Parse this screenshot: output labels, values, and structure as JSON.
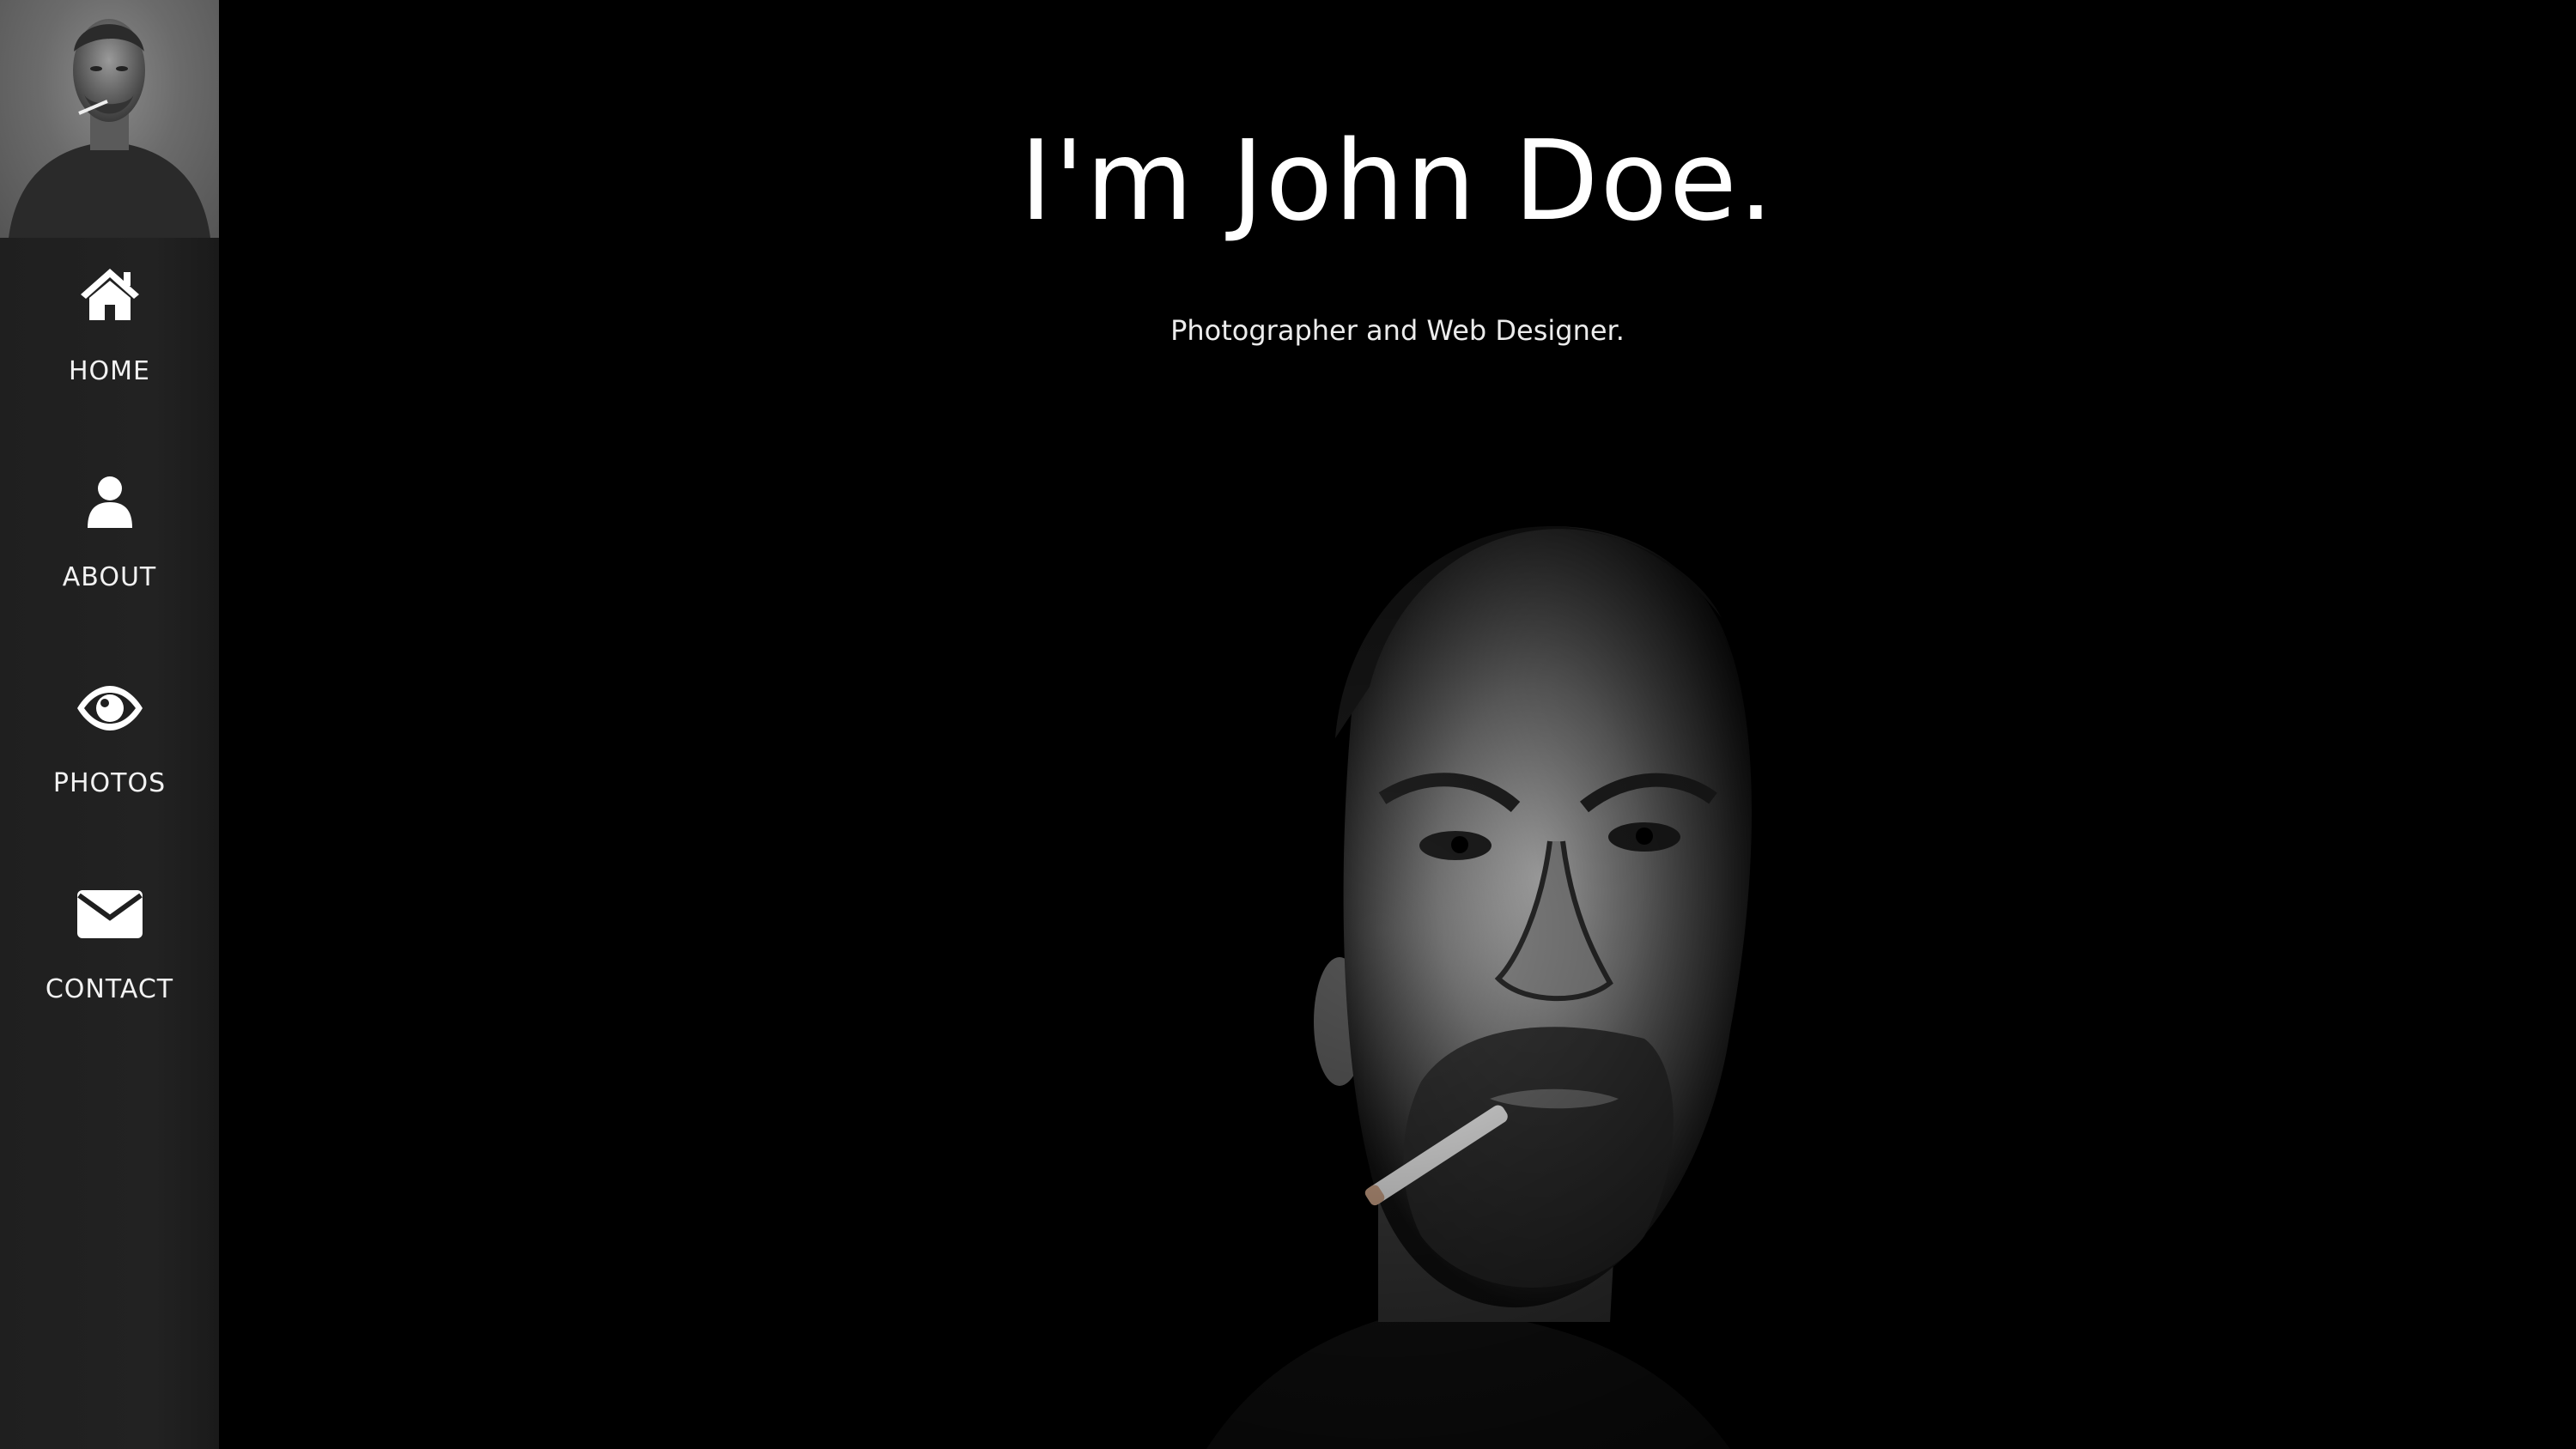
{
  "sidebar": {
    "avatar_alt": "Profile photo",
    "items": [
      {
        "label": "HOME",
        "icon": "home-icon"
      },
      {
        "label": "ABOUT",
        "icon": "user-icon"
      },
      {
        "label": "PHOTOS",
        "icon": "eye-icon"
      },
      {
        "label": "CONTACT",
        "icon": "envelope-icon"
      }
    ]
  },
  "hero": {
    "title": "I'm John Doe.",
    "subtitle": "Photographer and Web Designer."
  },
  "colors": {
    "background": "#000000",
    "sidebar": "#222222",
    "text": "#ffffff"
  }
}
